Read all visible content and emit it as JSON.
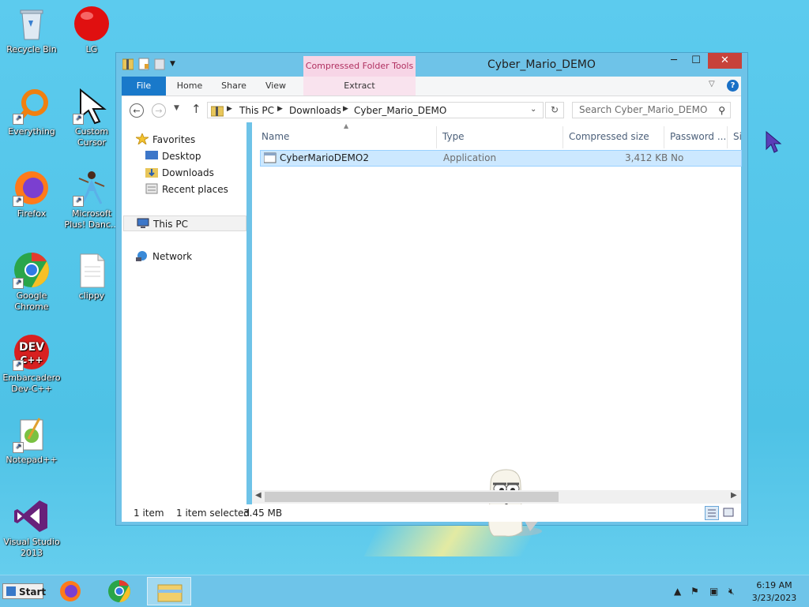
{
  "desktop": {
    "icons": [
      {
        "label": "Recycle Bin",
        "icon": "recycle-bin-icon"
      },
      {
        "label": "LG",
        "icon": "red-ball-icon"
      },
      {
        "label": "Everything",
        "icon": "everything-search-icon"
      },
      {
        "label": "Custom Cursor",
        "icon": "cursor-icon"
      },
      {
        "label": "Firefox",
        "icon": "firefox-icon"
      },
      {
        "label": "Microsoft Plus! Danc...",
        "icon": "dancer-icon"
      },
      {
        "label": "Google Chrome",
        "icon": "chrome-icon"
      },
      {
        "label": "clippy",
        "icon": "text-file-icon"
      },
      {
        "label": "Embarcadero Dev-C++",
        "icon": "dev-cpp-icon"
      },
      {
        "label": "Notepad++",
        "icon": "notepad-plus-icon"
      },
      {
        "label": "Visual Studio 2013",
        "icon": "visual-studio-icon"
      }
    ]
  },
  "window": {
    "title": "Cyber_Mario_DEMO",
    "context_tab": "Compressed Folder Tools",
    "ribbon_tabs": [
      "File",
      "Home",
      "Share",
      "View",
      "Extract"
    ],
    "address": {
      "crumbs": [
        "This PC",
        "Downloads",
        "Cyber_Mario_DEMO"
      ]
    },
    "search_placeholder": "Search Cyber_Mario_DEMO",
    "nav": {
      "favorites": "Favorites",
      "desktop": "Desktop",
      "downloads": "Downloads",
      "recent": "Recent places",
      "this_pc": "This PC",
      "network": "Network"
    },
    "columns": [
      "Name",
      "Type",
      "Compressed size",
      "Password ...",
      "Si"
    ],
    "files": [
      {
        "name": "CyberMarioDEMO2",
        "type": "Application",
        "compressed_size": "3,412 KB",
        "password": "No"
      }
    ],
    "status": {
      "count": "1 item",
      "selected": "1 item selected",
      "size": "3.45 MB"
    }
  },
  "taskbar": {
    "start_label": "Start",
    "time": "6:19 AM",
    "date": "3/23/2023"
  },
  "colors": {
    "desktop": "#4fc6ea",
    "file_tab": "#1979ca",
    "close_button": "#c7423a",
    "selection": "#cce8ff"
  }
}
